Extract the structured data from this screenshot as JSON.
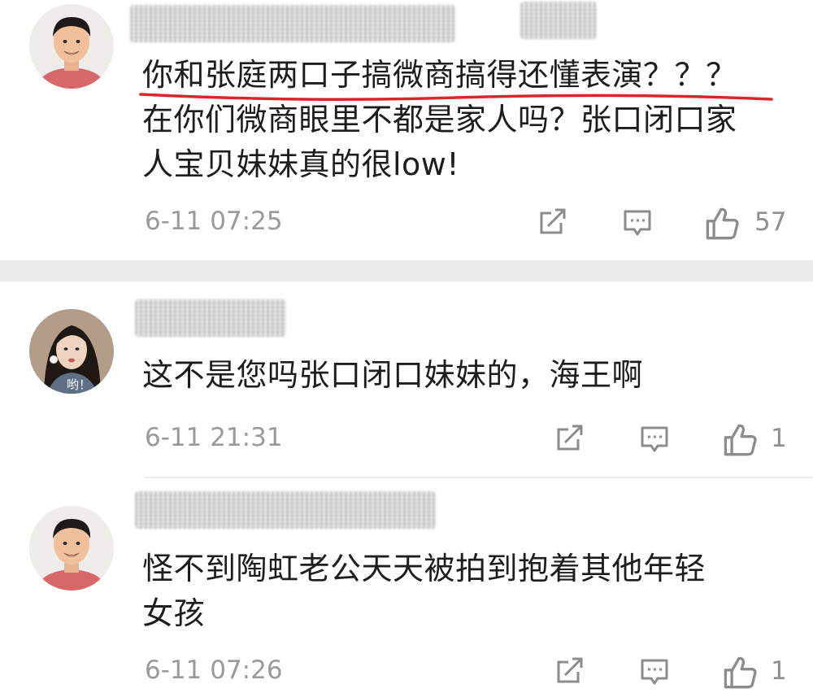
{
  "comments": [
    {
      "lines": [
        "你和张庭两口子搞微商搞得还懂表演？？？",
        "在你们微商眼里不都是家人吗？张口闭口家",
        "人宝贝妹妹真的很low!"
      ],
      "time": "6-11 07:25",
      "likes": "57",
      "avatar": "man-smiling-avatar"
    },
    {
      "lines": [
        "这不是您吗张口闭口妹妹的，海王啊"
      ],
      "time": "6-11 21:31",
      "likes": "1",
      "avatar": "woman-avatar",
      "avatar_caption": "哟！"
    },
    {
      "lines": [
        "怪不到陶虹老公天天被拍到抱着其他年轻",
        "女孩"
      ],
      "time": "6-11 07:26",
      "likes": "1",
      "avatar": "man-smiling-avatar"
    }
  ],
  "icons": [
    "share-icon",
    "comment-icon",
    "like-icon"
  ],
  "colors": {
    "underline": "#d9262c",
    "meta": "#9a9a9a",
    "divider": "#ececec"
  }
}
